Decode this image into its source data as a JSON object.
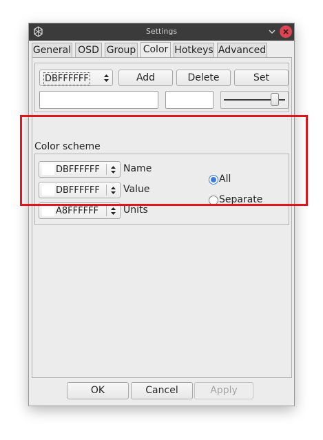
{
  "window": {
    "title": "Settings",
    "app_icon": "qmplay-icon",
    "minimize_icon": "chevron-down-icon",
    "close_icon": "close-icon"
  },
  "tabs": [
    {
      "label": "General"
    },
    {
      "label": "OSD"
    },
    {
      "label": "Group"
    },
    {
      "label": "Color",
      "active": true
    },
    {
      "label": "Hotkeys"
    },
    {
      "label": "Advanced"
    }
  ],
  "toolbar": {
    "color_combo_value": "DBFFFFFF",
    "add_label": "Add",
    "delete_label": "Delete",
    "set_label": "Set",
    "name_value": "",
    "preview_color": "#ffffff"
  },
  "color_scheme": {
    "title": "Color scheme",
    "rows": [
      {
        "value": "DBFFFFFF",
        "label": "Name"
      },
      {
        "value": "DBFFFFFF",
        "label": "Value"
      },
      {
        "value": "A8FFFFFF",
        "label": "Units"
      }
    ],
    "radios": [
      {
        "label": "All",
        "checked": true
      },
      {
        "label": "Separate",
        "checked": false
      }
    ]
  },
  "footer": {
    "ok_label": "OK",
    "cancel_label": "Cancel",
    "apply_label": "Apply"
  },
  "annotation": {
    "color": "#e0161b"
  }
}
